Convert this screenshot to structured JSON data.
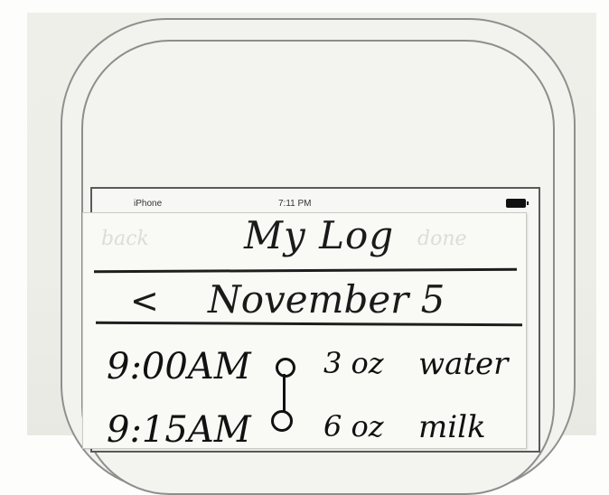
{
  "status_bar": {
    "carrier": "iPhone",
    "time": "7:11 PM"
  },
  "nav": {
    "back_label": "back",
    "done_label": "done",
    "title": "My Log"
  },
  "date_nav": {
    "prev_label": "<",
    "date": "November 5"
  },
  "log_entries": [
    {
      "time": "9:00AM",
      "amount": "3 oz",
      "item": "water"
    },
    {
      "time": "9:15AM",
      "amount": "6 oz",
      "item": "milk"
    }
  ]
}
